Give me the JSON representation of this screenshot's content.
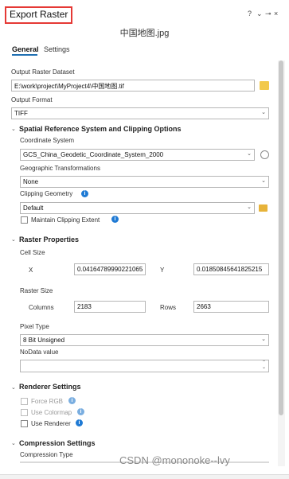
{
  "header": {
    "title": "Export Raster",
    "help": "?",
    "menu": "⌄",
    "pin": "⊸",
    "close": "×"
  },
  "filename": "中国地图.jpg",
  "tabs": [
    "General",
    "Settings"
  ],
  "output_dataset": {
    "label": "Output Raster Dataset",
    "value": "E:\\work\\project\\MyProject4\\中国地图.tif"
  },
  "output_format": {
    "label": "Output Format",
    "value": "TIFF"
  },
  "spatial": {
    "section": "Spatial Reference System and Clipping Options",
    "coord_label": "Coordinate System",
    "coord_value": "GCS_China_Geodetic_Coordinate_System_2000",
    "geo_trans_label": "Geographic Transformations",
    "geo_trans_value": "None",
    "clip_label": "Clipping Geometry",
    "clip_value": "Default",
    "maintain_label": "Maintain Clipping Extent"
  },
  "raster": {
    "section": "Raster Properties",
    "cell_size_label": "Cell Size",
    "x_label": "X",
    "x_value": "0.04164789990221065",
    "y_label": "Y",
    "y_value": "0.01850845641825215",
    "raster_size_label": "Raster Size",
    "columns_label": "Columns",
    "columns_value": "2183",
    "rows_label": "Rows",
    "rows_value": "2663",
    "pixel_type_label": "Pixel Type",
    "pixel_type_value": "8 Bit Unsigned",
    "nodata_label": "NoData value",
    "nodata_value": ""
  },
  "renderer": {
    "section": "Renderer Settings",
    "force_rgb": "Force RGB",
    "use_colormap": "Use Colormap",
    "use_renderer": "Use Renderer"
  },
  "compression": {
    "section": "Compression Settings",
    "type_label": "Compression Type"
  },
  "watermark": "CSDN @mononoke--lvy",
  "colors": {
    "accent": "#1f6fb2",
    "title_border": "#e53935",
    "info": "#1f7ad4"
  }
}
